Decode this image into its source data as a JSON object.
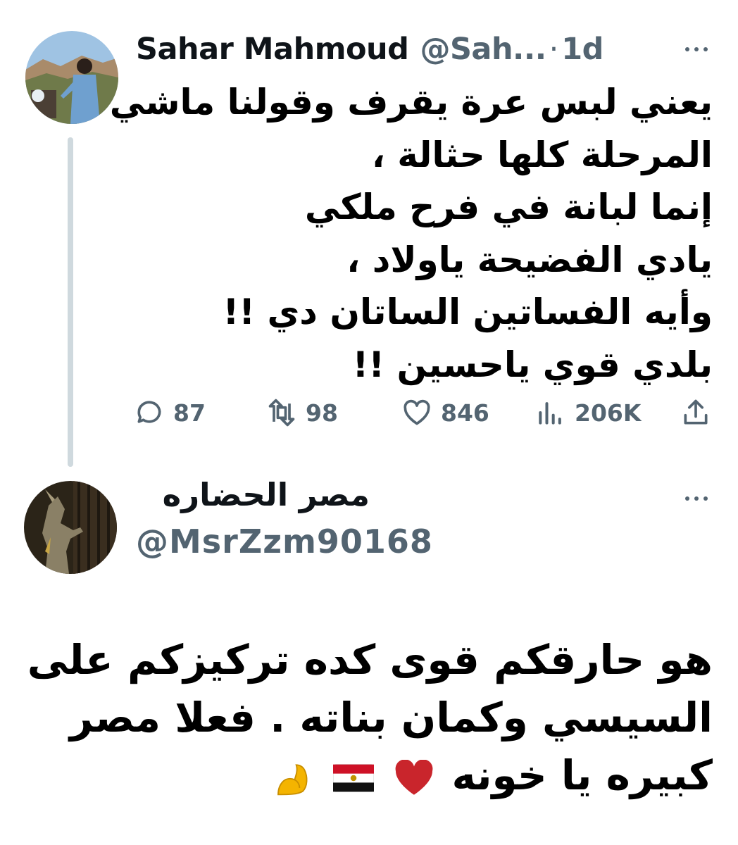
{
  "tweet": {
    "author_name": "Sahar Mahmoud",
    "author_handle": "@Sah...",
    "separator": "·",
    "time": "1d",
    "lines": [
      "يعني لبس عرة يقرف وقولنا ماشي",
      "المرحلة كلها حثالة ،",
      "إنما لبانة في فرح ملكي",
      "يادي الفضيحة ياولاد ،",
      "وأيه الفساتين الساتان دي !!",
      "بلدي قوي ياحسين !!"
    ],
    "stats": {
      "replies": "87",
      "retweets": "98",
      "likes": "846",
      "views": "206K"
    }
  },
  "reply": {
    "author_name": "مصر الحضاره",
    "author_handle": "@MsrZzm90168",
    "lines": [
      "هو حارقكم قوى كده تركيزكم على",
      "السيسي وكمان بناته . فعلا مصر",
      "كبيره يا خونه"
    ],
    "emoji": [
      "red-heart",
      "egypt-flag",
      "flexed-biceps"
    ]
  },
  "colors": {
    "text": "#0f1419",
    "secondary": "#536471",
    "thread_line": "#cfd9de",
    "heart": "#c9252c"
  }
}
